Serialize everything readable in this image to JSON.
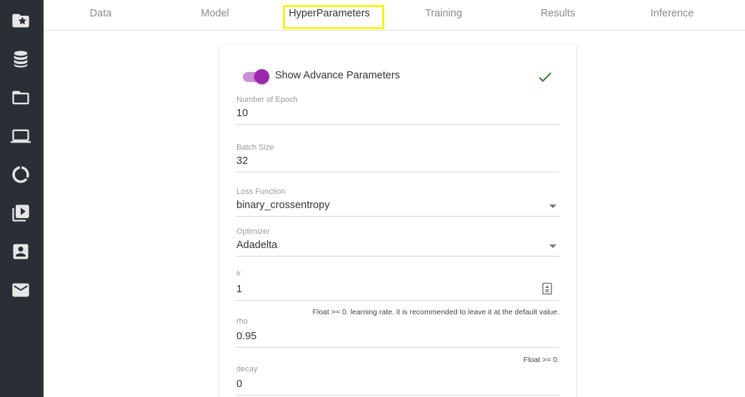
{
  "sidebar": {
    "icons": [
      "folder-star-icon",
      "database-icon",
      "folder-icon",
      "laptop-icon",
      "donut-chart-icon",
      "video-library-icon",
      "contact-card-icon",
      "mail-icon"
    ]
  },
  "tabs": [
    "Data",
    "Model",
    "HyperParameters",
    "Training",
    "Results",
    "Inference"
  ],
  "active_tab": "HyperParameters",
  "card": {
    "toggle_label": "Show Advance Parameters",
    "toggle_on": true,
    "fields": {
      "epoch": {
        "label": "Number of Epoch",
        "value": "10"
      },
      "batch": {
        "label": "Batch Size",
        "value": "32"
      },
      "loss": {
        "label": "Loss Function",
        "value": "binary_crossentropy"
      },
      "optimizer": {
        "label": "Optimizer",
        "value": "Adadelta"
      },
      "lr": {
        "label": "lr",
        "value": "1",
        "helper": "Float >= 0. learning rate. it is recommended to leave it at the default value."
      },
      "rho": {
        "label": "rho",
        "value": "0.95",
        "helper": "Float >= 0."
      },
      "decay": {
        "label": "decay",
        "value": "0"
      }
    }
  },
  "colors": {
    "sidebar_bg": "#2a2f36",
    "sidebar_icon": "#e6e6e6",
    "toggle_accent": "#9c27b0",
    "check": "#2e7d32",
    "tab_highlight": "#f5f51a"
  }
}
